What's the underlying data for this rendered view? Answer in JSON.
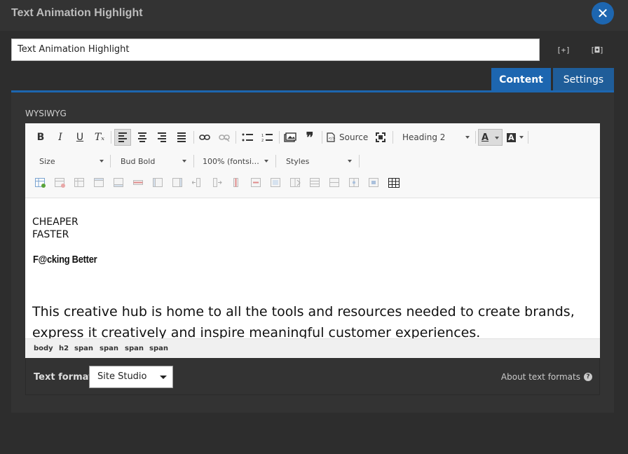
{
  "dialog": {
    "title": "Text Animation Highlight",
    "close_glyph": "✕"
  },
  "title_field": {
    "value": "Text Animation Highlight"
  },
  "header_buttons": {
    "expand_glyph": "[+]",
    "fullscreen_glyph": "[◘]"
  },
  "tabs": [
    {
      "label": "Content",
      "active": true
    },
    {
      "label": "Settings",
      "active": false
    }
  ],
  "field": {
    "label": "WYSIWYG"
  },
  "toolbar": {
    "row1": {
      "bold": "B",
      "italic": "I",
      "underline": "U",
      "clear_format": "Tₓ",
      "blockquote": "❞",
      "source_label": "Source",
      "format_combo": "Heading 2",
      "text_color": "A",
      "bg_color": "A"
    },
    "row2": {
      "size_combo": "Size",
      "font_combo": "Bud Bold",
      "zoom_combo": "100% (fontsi…",
      "styles_combo": "Styles"
    }
  },
  "content": {
    "line1": "CHEAPER",
    "line2": "FASTER",
    "heading": "F@cking Better",
    "paragraph": "This creative hub is home to all the tools and resources needed to create brands, express it creatively and inspire meaningful customer experiences."
  },
  "elements_path": [
    "body",
    "h2",
    "span",
    "span",
    "span",
    "span"
  ],
  "text_format": {
    "label": "Text format",
    "selected": "Site Studio",
    "about_link": "About text formats",
    "help_glyph": "?"
  },
  "colors": {
    "accent": "#1d66b0",
    "panel": "#333333",
    "background": "#2d2d2d"
  }
}
